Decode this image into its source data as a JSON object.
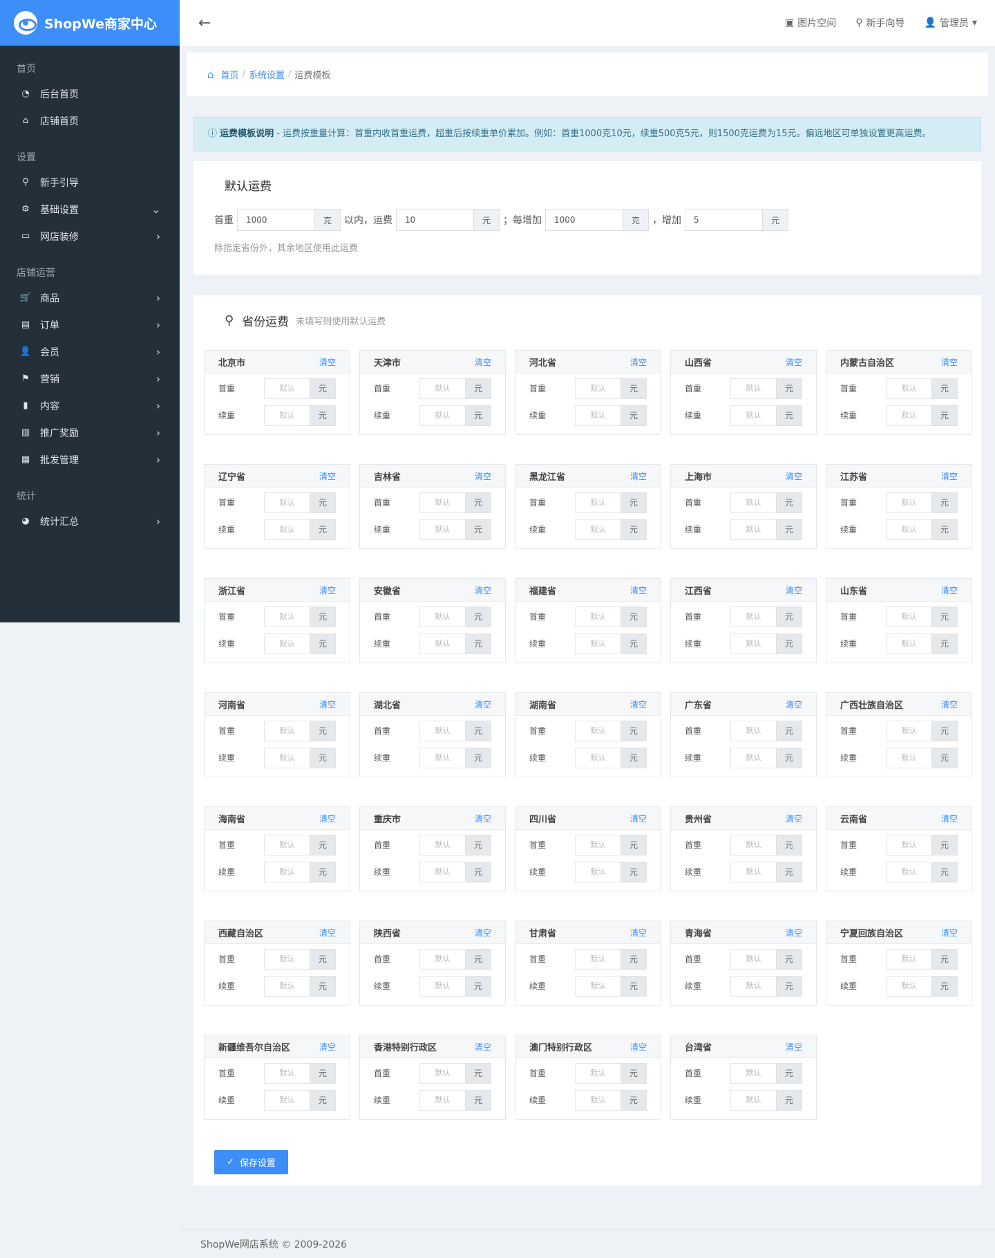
{
  "brand": {
    "name": "ShopWe商家中心"
  },
  "topbar": {
    "back": "←",
    "images": "图片空间",
    "guide": "新手向导",
    "user": "管理员"
  },
  "sidebar": {
    "groups": [
      {
        "title": "首页",
        "items": [
          {
            "label": "后台首页"
          },
          {
            "label": "店铺首页"
          }
        ]
      },
      {
        "title": "设置",
        "items": [
          {
            "label": "新手引导"
          },
          {
            "label": "基础设置"
          },
          {
            "label": "网店装修"
          }
        ]
      },
      {
        "title": "店铺运营",
        "items": [
          {
            "label": "商品"
          },
          {
            "label": "订单"
          },
          {
            "label": "会员"
          },
          {
            "label": "营销"
          },
          {
            "label": "内容"
          },
          {
            "label": "推广奖励"
          },
          {
            "label": "批发管理"
          }
        ]
      },
      {
        "title": "统计",
        "items": [
          {
            "label": "统计汇总"
          }
        ]
      }
    ]
  },
  "breadcrumb": {
    "home": "首页",
    "parent": "系统设置",
    "current": "运费模板",
    "sep": "/"
  },
  "alert": {
    "title": "运费模板说明",
    "text": " - 运费按重量计算：首重内收首重运费，超重后按续重单价累加。例如：首重1000克10元，续重500克5元，则1500克运费为15元。偏远地区可单独设置更高运费。"
  },
  "default_fee": {
    "title": "默认运费",
    "first_weight_label": "首重",
    "first_weight": "1000",
    "gram_unit": "克",
    "within_label": "以内，运费",
    "first_fee": "10",
    "yuan_unit": "元",
    "each_add_label": "；每增加",
    "add_weight": "1000",
    "increase_label": "，增加",
    "add_fee": "5",
    "hint": "除指定省份外，其余地区使用此运费"
  },
  "province_fee": {
    "title": "省份运费",
    "subtitle": "未填写则使用默认运费",
    "clear_label": "清空",
    "first_label": "首重",
    "next_label": "续重",
    "placeholder": "默认",
    "unit": "元",
    "provinces": [
      "北京市",
      "天津市",
      "河北省",
      "山西省",
      "内蒙古自治区",
      "辽宁省",
      "吉林省",
      "黑龙江省",
      "上海市",
      "江苏省",
      "浙江省",
      "安徽省",
      "福建省",
      "江西省",
      "山东省",
      "河南省",
      "湖北省",
      "湖南省",
      "广东省",
      "广西壮族自治区",
      "海南省",
      "重庆市",
      "四川省",
      "贵州省",
      "云南省",
      "西藏自治区",
      "陕西省",
      "甘肃省",
      "青海省",
      "宁夏回族自治区",
      "新疆维吾尔自治区",
      "香港特别行政区",
      "澳门特别行政区",
      "台湾省"
    ]
  },
  "save_label": "保存设置",
  "footer": "ShopWe网店系统 © 2009-2026"
}
